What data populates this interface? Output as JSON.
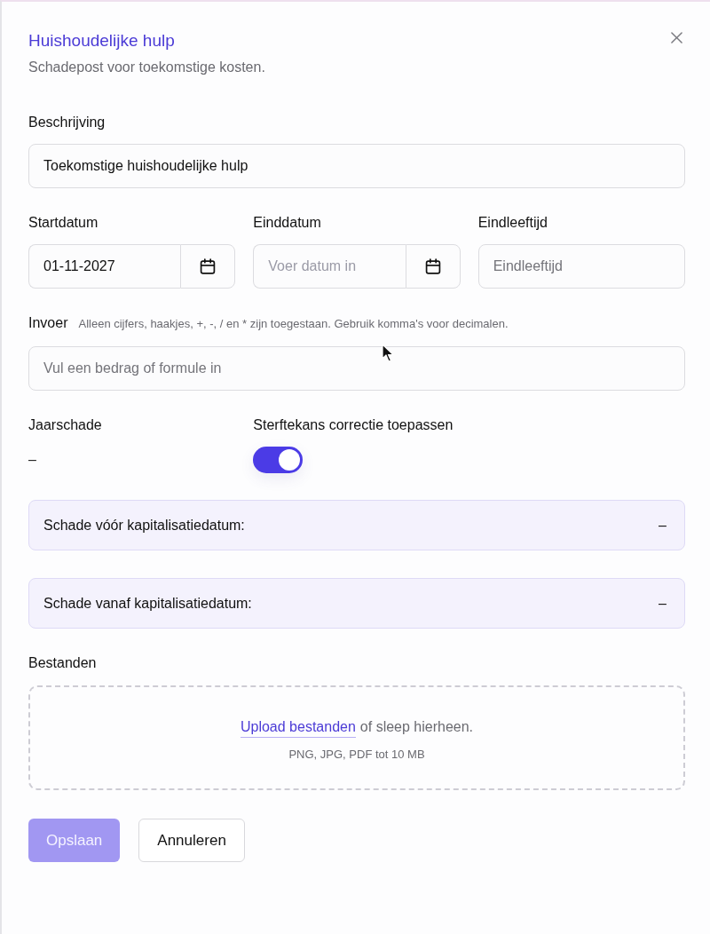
{
  "dialog": {
    "title": "Huishoudelijke hulp",
    "subtitle": "Schadepost voor toekomstige kosten."
  },
  "description": {
    "label": "Beschrijving",
    "value": "Toekomstige huishoudelijke hulp"
  },
  "date_fields": [
    {
      "label": "Startdatum",
      "kind": "date",
      "value": "01-11-2027"
    },
    {
      "label": "Einddatum",
      "kind": "date",
      "placeholder": "Voer datum in"
    },
    {
      "label": "Eindleeftijd",
      "kind": "text",
      "placeholder": "Eindleeftijd"
    }
  ],
  "input": {
    "label": "Invoer",
    "hint": "Alleen cijfers, haakjes, +, -, / en * zijn toegestaan. Gebruik komma's voor decimalen.",
    "placeholder": "Vul een bedrag of formule in"
  },
  "annual_damage": {
    "label": "Jaarschade",
    "value": "–"
  },
  "mortality_correction": {
    "label": "Sterftekans correctie toepassen",
    "on": true
  },
  "summaries": [
    {
      "label": "Schade vóór kapitalisatiedatum:",
      "value": "–"
    },
    {
      "label": "Schade vanaf kapitalisatiedatum:",
      "value": "–"
    }
  ],
  "files": {
    "label": "Bestanden",
    "link": "Upload bestanden",
    "text": "of sleep hierheen.",
    "hint": "PNG, JPG, PDF tot 10 MB"
  },
  "buttons": [
    {
      "label": "Opslaan",
      "kind": "primary",
      "disabled": true
    },
    {
      "label": "Annuleren",
      "kind": "secondary",
      "disabled": false
    }
  ]
}
